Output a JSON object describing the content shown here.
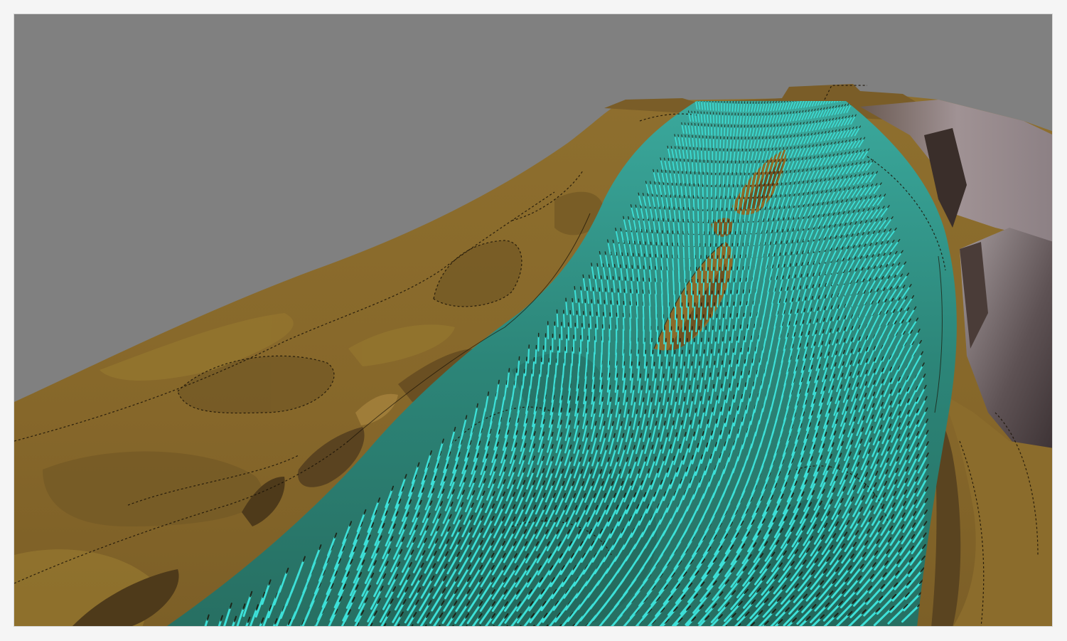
{
  "scene": {
    "kind": "3d-terrain-flow-visualization",
    "colors": {
      "frame": "#f5f5f5",
      "sky": "#808080",
      "terrain_base": "#86672a",
      "terrain_dark": "#6f5422",
      "terrain_light": "#9a7a36",
      "bank_shadow": "#4e3a1a",
      "cliff_light": "#a89a9c",
      "cliff_mid": "#8a7c78",
      "cliff_dark": "#5c4c44",
      "water": "#2e8a7e",
      "water_deep": "#1f6a60",
      "vector": "#3de0d8",
      "contour": "#1a1206"
    },
    "icons": {
      "vectors": "cyan-flow-vector-arrows",
      "contours": "dashed-elevation-contour-lines"
    },
    "vector_field": {
      "rows": 46,
      "columns": 54
    }
  }
}
